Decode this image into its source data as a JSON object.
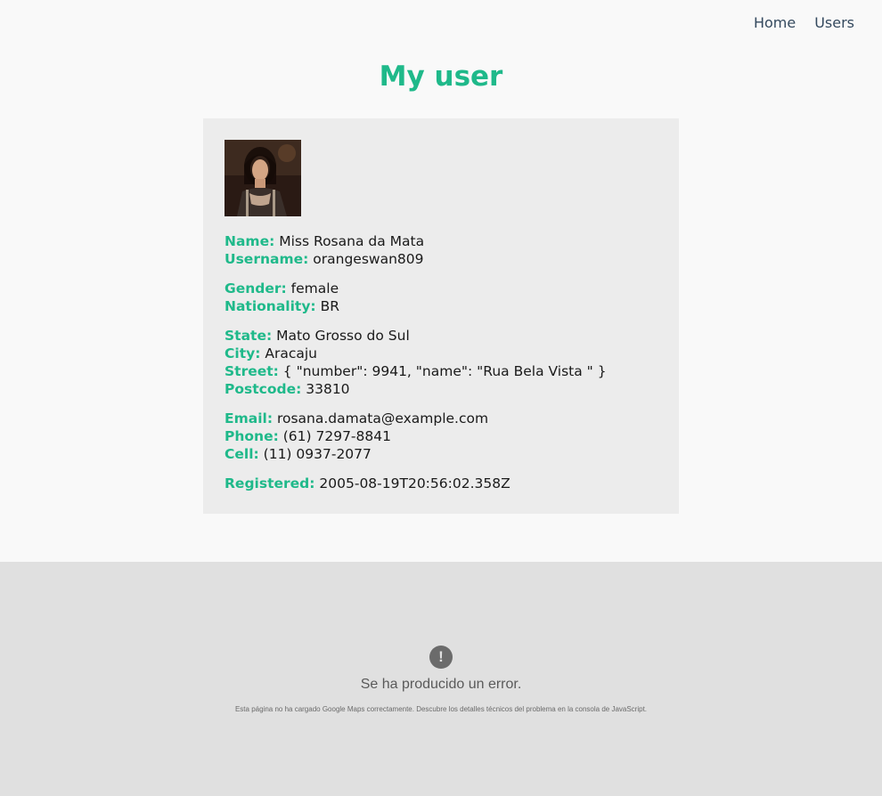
{
  "nav": {
    "home": "Home",
    "users": "Users"
  },
  "page": {
    "title": "My user"
  },
  "user": {
    "name_label": "Name:",
    "name": "Miss Rosana da Mata",
    "username_label": "Username:",
    "username": "orangeswan809",
    "gender_label": "Gender:",
    "gender": "female",
    "nationality_label": "Nationality:",
    "nationality": "BR",
    "state_label": "State:",
    "state": "Mato Grosso do Sul",
    "city_label": "City:",
    "city": "Aracaju",
    "street_label": "Street:",
    "street": "{ \"number\": 9941, \"name\": \"Rua Bela Vista \" }",
    "postcode_label": "Postcode:",
    "postcode": "33810",
    "email_label": "Email:",
    "email": "rosana.damata@example.com",
    "phone_label": "Phone:",
    "phone": "(61) 7297-8841",
    "cell_label": "Cell:",
    "cell": "(11) 0937-2077",
    "registered_label": "Registered:",
    "registered": "2005-08-19T20:56:02.358Z"
  },
  "map_error": {
    "icon": "exclamation-icon",
    "icon_glyph": "!",
    "title": "Se ha producido un error.",
    "detail": "Esta página no ha cargado Google Maps correctamente. Descubre los detalles técnicos del problema en la consola de JavaScript."
  },
  "colors": {
    "accent": "#1fb98a",
    "nav_text": "#34495e",
    "card_bg": "#ececec",
    "page_bg": "#f9f9f9",
    "map_bg": "#e0e0e0"
  }
}
